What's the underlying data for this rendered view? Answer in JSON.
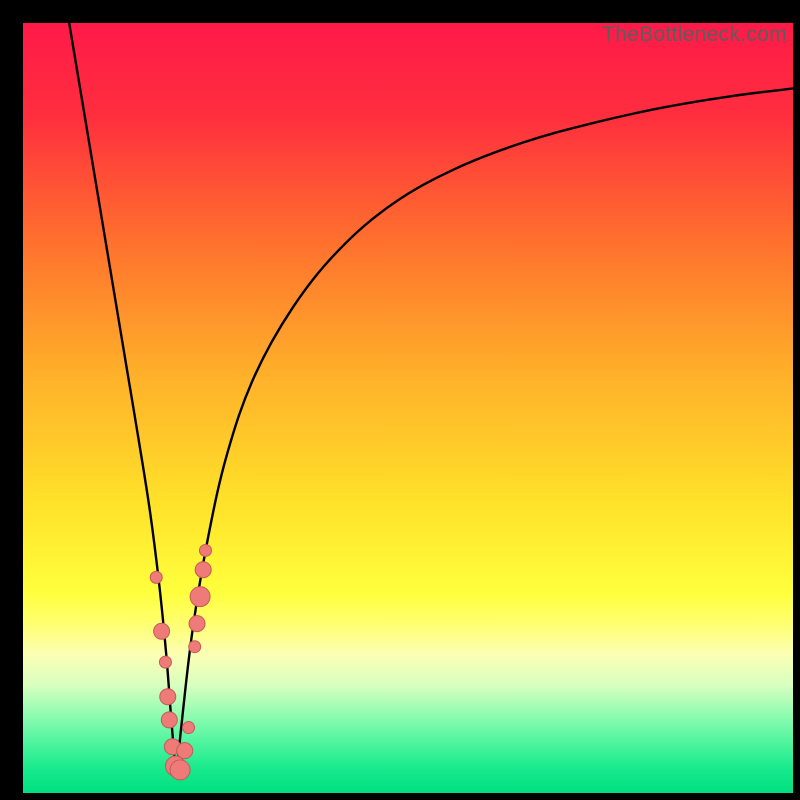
{
  "attribution": "TheBottleneck.com",
  "chart_data": {
    "type": "line",
    "title": "",
    "xlabel": "",
    "ylabel": "",
    "xlim": [
      0,
      100
    ],
    "ylim": [
      0,
      100
    ],
    "grid": false,
    "legend": false,
    "background_gradient": {
      "stops": [
        {
          "offset": 0.0,
          "color": "#ff1a49"
        },
        {
          "offset": 0.12,
          "color": "#ff2e3e"
        },
        {
          "offset": 0.28,
          "color": "#ff6f2e"
        },
        {
          "offset": 0.45,
          "color": "#ffae2a"
        },
        {
          "offset": 0.62,
          "color": "#ffe129"
        },
        {
          "offset": 0.74,
          "color": "#ffff3d"
        },
        {
          "offset": 0.78,
          "color": "#ffff70"
        },
        {
          "offset": 0.82,
          "color": "#fbffb4"
        },
        {
          "offset": 0.86,
          "color": "#d8ffbf"
        },
        {
          "offset": 0.9,
          "color": "#8dfcb0"
        },
        {
          "offset": 0.94,
          "color": "#45f39c"
        },
        {
          "offset": 0.97,
          "color": "#16e98c"
        },
        {
          "offset": 1.0,
          "color": "#00e080"
        }
      ]
    },
    "series": [
      {
        "name": "left-branch",
        "stroke": "#000000",
        "x": [
          6.0,
          7.5,
          9.0,
          10.5,
          12.0,
          13.5,
          15.0,
          16.5,
          17.7,
          18.6,
          19.3,
          19.9
        ],
        "y": [
          100.0,
          91.0,
          82.0,
          73.0,
          64.0,
          55.0,
          46.0,
          36.5,
          27.0,
          18.0,
          9.0,
          2.0
        ]
      },
      {
        "name": "right-branch",
        "stroke": "#000000",
        "x": [
          19.9,
          20.6,
          22.0,
          24.0,
          26.5,
          30.0,
          35.0,
          41.0,
          48.0,
          56.0,
          65.0,
          74.0,
          83.0,
          92.0,
          100.0
        ],
        "y": [
          2.0,
          9.0,
          21.0,
          33.0,
          44.0,
          54.0,
          63.0,
          70.5,
          76.5,
          81.0,
          84.5,
          87.0,
          89.0,
          90.5,
          91.5
        ]
      }
    ],
    "markers": {
      "name": "data-points",
      "fill": "#ee7b78",
      "stroke": "#c45a59",
      "points": [
        {
          "x": 17.3,
          "y": 28.0,
          "r": 6
        },
        {
          "x": 18.0,
          "y": 21.0,
          "r": 8
        },
        {
          "x": 18.5,
          "y": 17.0,
          "r": 6
        },
        {
          "x": 18.8,
          "y": 12.5,
          "r": 8
        },
        {
          "x": 19.0,
          "y": 9.5,
          "r": 8
        },
        {
          "x": 19.4,
          "y": 6.0,
          "r": 8
        },
        {
          "x": 19.8,
          "y": 3.5,
          "r": 10
        },
        {
          "x": 20.4,
          "y": 3.0,
          "r": 10
        },
        {
          "x": 21.0,
          "y": 5.5,
          "r": 8
        },
        {
          "x": 21.5,
          "y": 8.5,
          "r": 6
        },
        {
          "x": 22.3,
          "y": 19.0,
          "r": 6
        },
        {
          "x": 22.6,
          "y": 22.0,
          "r": 8
        },
        {
          "x": 23.0,
          "y": 25.5,
          "r": 10
        },
        {
          "x": 23.4,
          "y": 29.0,
          "r": 8
        },
        {
          "x": 23.7,
          "y": 31.5,
          "r": 6
        }
      ]
    }
  }
}
